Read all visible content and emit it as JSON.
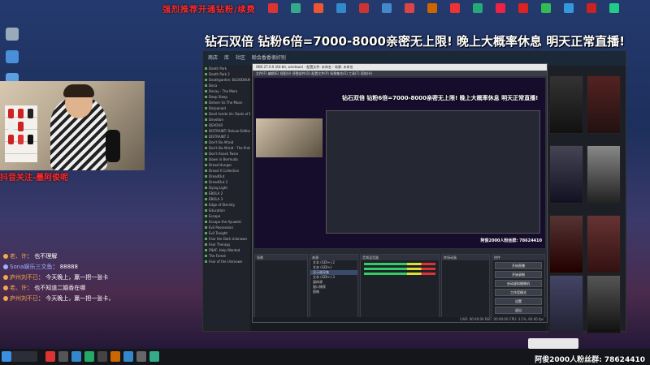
{
  "banner": {
    "red_top": "强烈推荐开通钻粉/续费",
    "main": "钻石双倍 钻粉6倍=7000-8000亲密无上限! 晚上大概率休息 明天正常直播!"
  },
  "follow_prompt": "抖音关注-墨阿俊呢",
  "comments": [
    {
      "user": "老、许",
      "msg": "也不理解"
    },
    {
      "user": "Sona娱乐三文鱼",
      "msg": "88888"
    },
    {
      "user": "庐州刘不已",
      "msg": "今天晚上，赢一把一张卡"
    },
    {
      "user": "老、许",
      "msg": "也不知道二婚香在哪"
    },
    {
      "user": "庐州刘不已",
      "msg": "今天晚上，赢一把一张卡，"
    }
  ],
  "steam": {
    "tabs": [
      "商店",
      "库",
      "社区",
      "聪会香香很好别"
    ],
    "library_items": [
      "Death Park",
      "Death Park 2",
      "Deathgarden: BLOODHUNT",
      "Deca",
      "Decay - The Mare",
      "Deep Sleep",
      "Deliver Us The Moon",
      "Derpanoid",
      "Devil Inside Us: Roots of Evil",
      "Devotion",
      "DEVOUR",
      "DISTRAINT: Deluxe Edition",
      "DISTRAINT 2",
      "Don't Be Afraid",
      "Don't Be Afraid - The Prologue",
      "Don't Knock Twice",
      "Down in Bermuda",
      "Dread Hunger",
      "Dread X Collection",
      "DreadOut",
      "DreadOut 2",
      "Dying Light",
      "EBOLA 2",
      "EBOLA 3",
      "Edge of Eternity",
      "Education",
      "Escape",
      "Escape the Ayuwoki",
      "Evil Possession",
      "Evil Tonight",
      "Fear the Dark Unknown",
      "Fear Therapy",
      "FNAF: Help Wanted",
      "The Forest",
      "Fear of the Unknown"
    ]
  },
  "obs": {
    "title": "OBS 27.0.0 (64-bit, windows) - 配置文件: 未命名 - 场景: 未命名",
    "menu": [
      "文件(F)",
      "编辑(E)",
      "视图(V)",
      "停靠部件(D)",
      "配置文件(P)",
      "场景集合(S)",
      "工具(T)",
      "帮助(H)"
    ],
    "preview_banner": "钻石双倍 钻粉6倍=7000-8000亲密无上限! 晚上大概率休息 明天正常直播!",
    "preview_footer": "阿俊2000人粉丝群: 78624410",
    "scenes_header": "场景",
    "sources_header": "来源",
    "sources": [
      "文本 (GDI+) 2",
      "文本 (GDI+)",
      "显示器采集",
      "文本 (GDI+) 3",
      "媒体源",
      "窗口捕获",
      "图像"
    ],
    "mixer_header": "音频混音器",
    "transition_header": "转场动画",
    "controls_header": "控件",
    "controls": [
      "开始直播",
      "开始录制",
      "启动虚拟摄像机",
      "工作室模式",
      "设置",
      "退出"
    ],
    "status": "LIVE: 00:00:00  REC: 00:00:00  CPU: 3.1%, 60.00 fps"
  },
  "fans_footer": "阿俊2000人粉丝群: 78624410",
  "colors": {
    "accent_red": "#ff2a2a",
    "chat_user": "#f4a84a",
    "chat_green": "#9fe39f"
  }
}
